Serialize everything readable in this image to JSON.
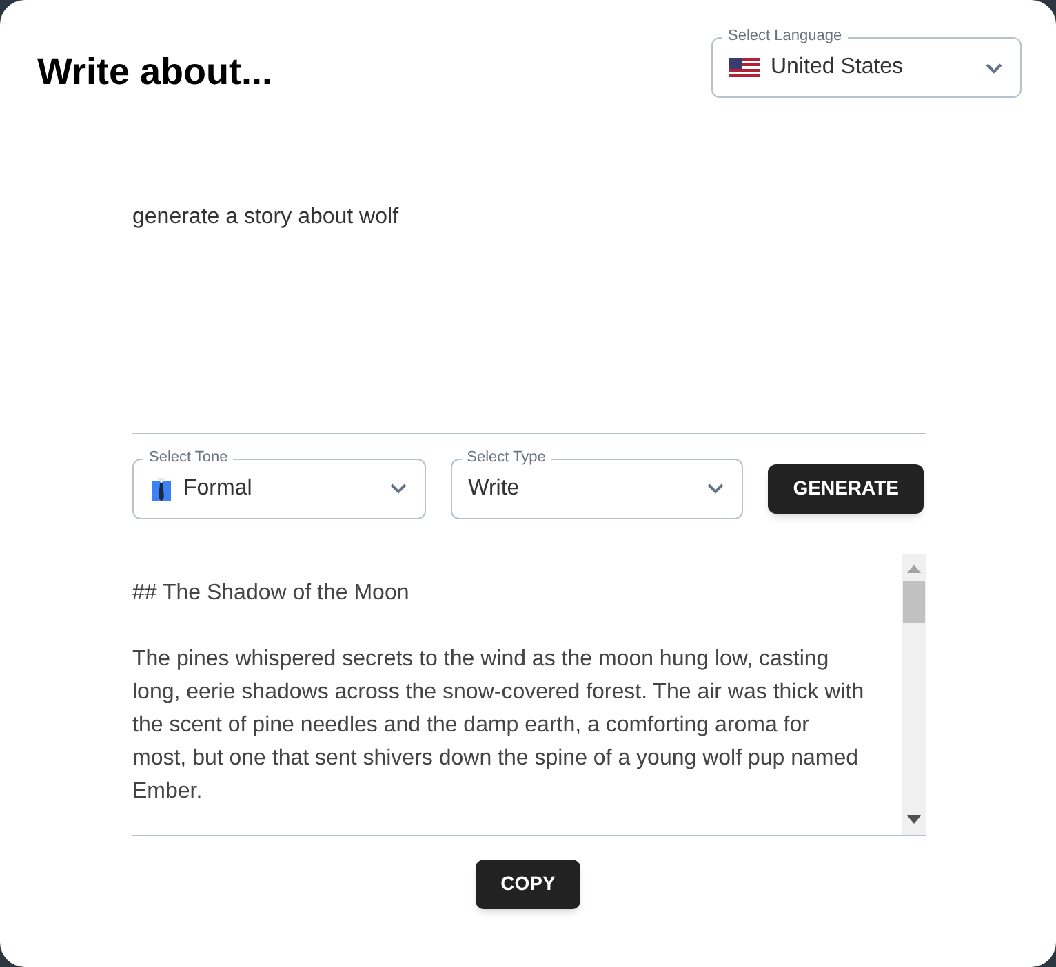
{
  "title": "Write about...",
  "language": {
    "label": "Select Language",
    "value": "United States"
  },
  "prompt": {
    "value": "generate a story about wolf"
  },
  "tone": {
    "label": "Select Tone",
    "value": "Formal"
  },
  "type": {
    "label": "Select Type",
    "value": "Write"
  },
  "generate_button": "GENERATE",
  "output": [
    "## The Shadow of the Moon",
    "The pines whispered secrets to the wind as the moon hung low, casting long, eerie shadows across the snow-covered forest. The air was thick with the scent of pine needles and the damp earth, a comforting aroma for most, but one that sent shivers down the spine of a young wolf pup named Ember."
  ],
  "copy_button": "COPY"
}
